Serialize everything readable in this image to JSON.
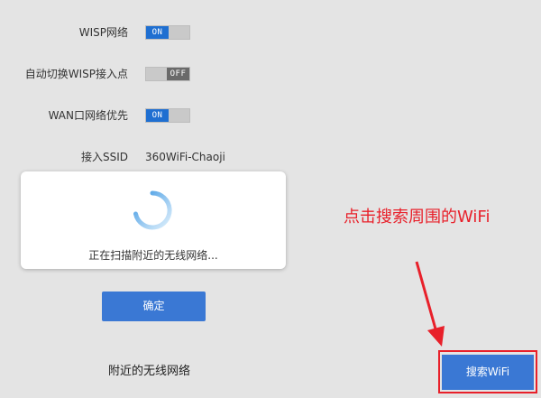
{
  "settings": {
    "wisp": {
      "label": "WISP网络",
      "state": "ON"
    },
    "auto_switch": {
      "label": "自动切换WISP接入点",
      "state": "OFF"
    },
    "wan_priority": {
      "label": "WAN口网络优先",
      "state": "ON"
    },
    "ssid": {
      "label": "接入SSID",
      "value": "360WiFi-Chaoji"
    }
  },
  "modal": {
    "message": "正在扫描附近的无线网络..."
  },
  "buttons": {
    "confirm": "确定",
    "search": "搜索WiFi"
  },
  "nearby_label": "附近的无线网络",
  "annotation": {
    "text": "点击搜索周围的WiFi"
  },
  "colors": {
    "accent": "#3a78d4",
    "toggle_on": "#1f6fd1",
    "annotation": "#e8202a"
  },
  "icons": {
    "spinner": "loading-spinner-icon",
    "arrow": "annotation-arrow"
  }
}
